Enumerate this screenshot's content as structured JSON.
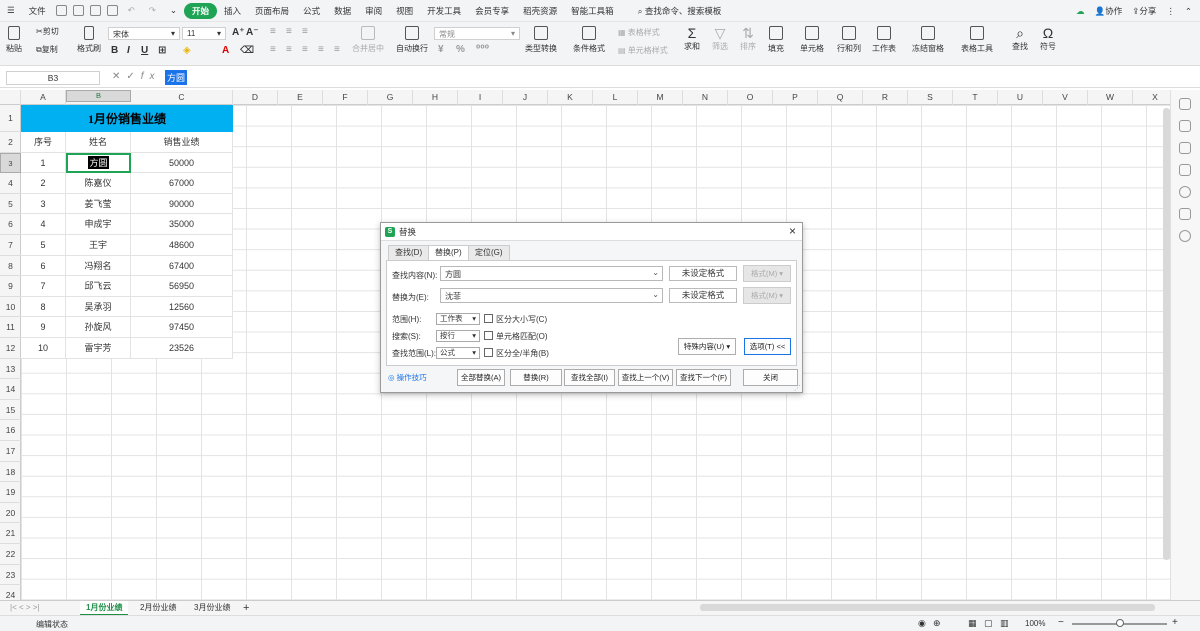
{
  "menubar": {
    "file_label": "文件",
    "tabs": [
      "开始",
      "插入",
      "页面布局",
      "公式",
      "数据",
      "审阅",
      "视图",
      "开发工具",
      "会员专享",
      "稻壳资源",
      "智能工具箱"
    ],
    "search_placeholder": "查找命令、搜索模板",
    "collab_label": "协作",
    "share_label": "分享"
  },
  "ribbon": {
    "cut": "剪切",
    "paste": "粘贴",
    "copy": "复制",
    "format_painter": "格式刷",
    "font_name": "宋体",
    "font_size": "11",
    "merge_center": "合并居中",
    "wrap_text": "自动换行",
    "number_format": "常规",
    "type_convert": "类型转换",
    "conditional_format": "条件格式",
    "table_style": "表格样式",
    "cell_style": "单元格样式",
    "sum": "求和",
    "filter": "筛选",
    "sort": "排序",
    "fill": "填充",
    "cell": "单元格",
    "row_col": "行和列",
    "worksheet": "工作表",
    "freeze": "冻结窗格",
    "table_tools": "表格工具",
    "find": "查找",
    "symbol": "符号"
  },
  "formula_bar": {
    "cell_ref": "B3",
    "value": "方圆"
  },
  "columns": [
    "A",
    "B",
    "C",
    "D",
    "E",
    "F",
    "G",
    "H",
    "I",
    "J",
    "K",
    "L",
    "M",
    "N",
    "O",
    "P",
    "Q",
    "R",
    "S",
    "T",
    "U",
    "V",
    "W",
    "X"
  ],
  "rows": [
    "1",
    "2",
    "3",
    "4",
    "5",
    "6",
    "7",
    "8",
    "9",
    "10",
    "11",
    "12",
    "13",
    "14",
    "15",
    "16",
    "17",
    "18",
    "19",
    "20",
    "21",
    "22",
    "23",
    "24"
  ],
  "table": {
    "title": "1月份销售业绩",
    "headers": [
      "序号",
      "姓名",
      "销售业绩"
    ],
    "data": [
      [
        "1",
        "方圆",
        "50000"
      ],
      [
        "2",
        "陈嘉仪",
        "67000"
      ],
      [
        "3",
        "姜飞莹",
        "90000"
      ],
      [
        "4",
        "申成宇",
        "35000"
      ],
      [
        "5",
        "王宇",
        "48600"
      ],
      [
        "6",
        "冯翔名",
        "67400"
      ],
      [
        "7",
        "邱飞云",
        "56950"
      ],
      [
        "8",
        "吴承羽",
        "12560"
      ],
      [
        "9",
        "孙旋风",
        "97450"
      ],
      [
        "10",
        "雷宇芳",
        "23526"
      ]
    ]
  },
  "sheet_tabs": [
    "1月份业绩",
    "2月份业绩",
    "3月份业绩"
  ],
  "status": {
    "mode": "编辑状态",
    "zoom": "100%"
  },
  "dialog": {
    "title": "替换",
    "tabs": [
      "查找(D)",
      "替换(P)",
      "定位(G)"
    ],
    "find_label": "查找内容(N):",
    "find_value": "方圆",
    "replace_label": "替换为(E):",
    "replace_value": "沈菲",
    "no_format": "未设定格式",
    "format_btn": "格式(M) ▾",
    "scope_label": "范围(H):",
    "scope_value": "工作表",
    "search_label": "搜索(S):",
    "search_value": "按行",
    "lookin_label": "查找范围(L):",
    "lookin_value": "公式",
    "match_case": "区分大小写(C)",
    "match_cell": "单元格匹配(O)",
    "match_width": "区分全/半角(B)",
    "special": "特殊内容(U) ▾",
    "options": "选项(T) <<",
    "tips": "操作技巧",
    "replace_all": "全部替换(A)",
    "replace": "替换(R)",
    "find_all": "查找全部(I)",
    "find_prev": "查找上一个(V)",
    "find_next": "查找下一个(F)",
    "close": "关闭"
  }
}
